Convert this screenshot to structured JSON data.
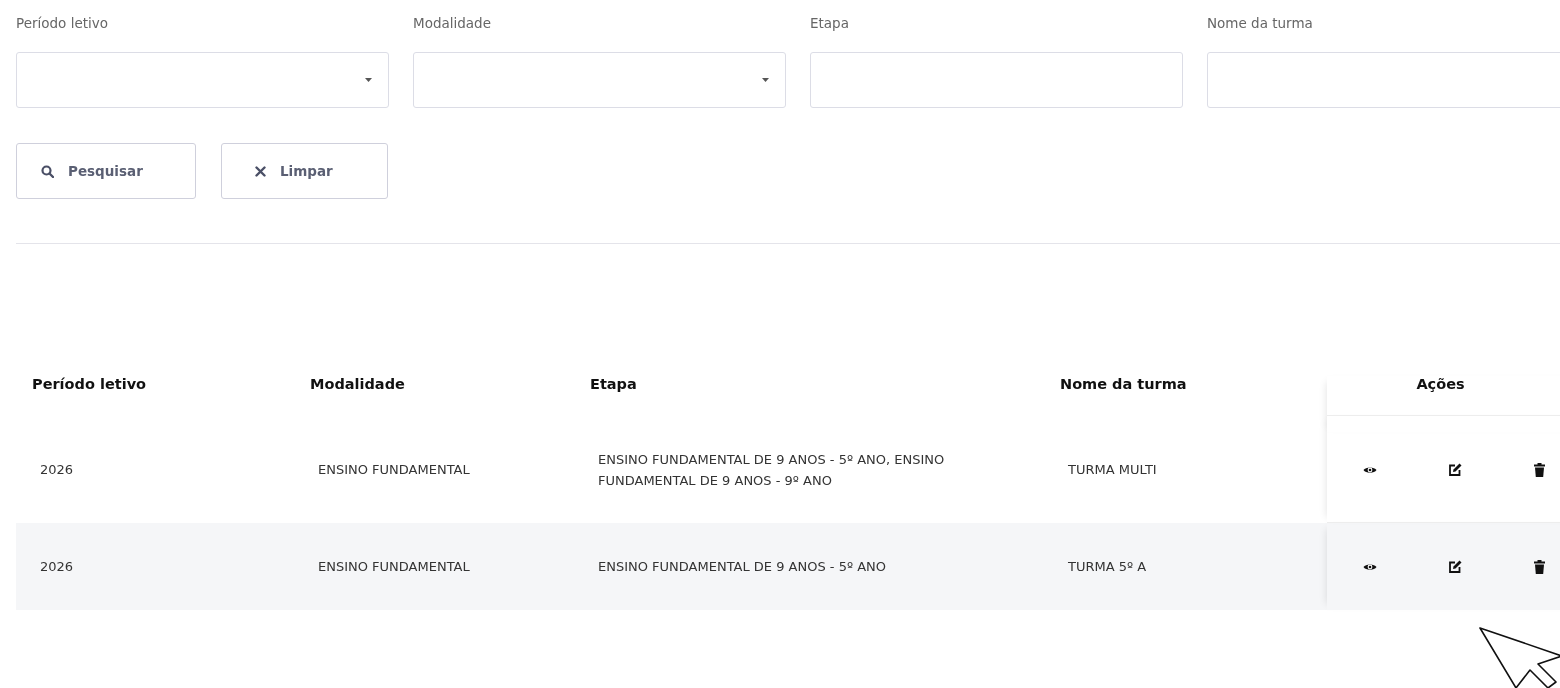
{
  "filters": [
    {
      "label": "Período letivo",
      "kind": "select"
    },
    {
      "label": "Modalidade",
      "kind": "select"
    },
    {
      "label": "Etapa",
      "kind": "text"
    },
    {
      "label": "Nome da turma",
      "kind": "text"
    }
  ],
  "buttons": [
    {
      "label": "Pesquisar",
      "kind": "search"
    },
    {
      "label": "Limpar",
      "kind": "clear"
    }
  ],
  "table": {
    "columns": [
      "Período letivo",
      "Modalidade",
      "Etapa",
      "Nome da turma",
      "Ações"
    ],
    "rows": [
      {
        "cells": [
          "2026",
          "ENSINO FUNDAMENTAL",
          "ENSINO FUNDAMENTAL DE 9 ANOS - 5º ANO, ENSINO FUNDAMENTAL DE 9 ANOS - 9º ANO",
          "TURMA MULTI"
        ]
      },
      {
        "cells": [
          "2026",
          "ENSINO FUNDAMENTAL",
          "ENSINO FUNDAMENTAL DE 9 ANOS - 5º ANO",
          "TURMA 5º A"
        ]
      }
    ]
  }
}
